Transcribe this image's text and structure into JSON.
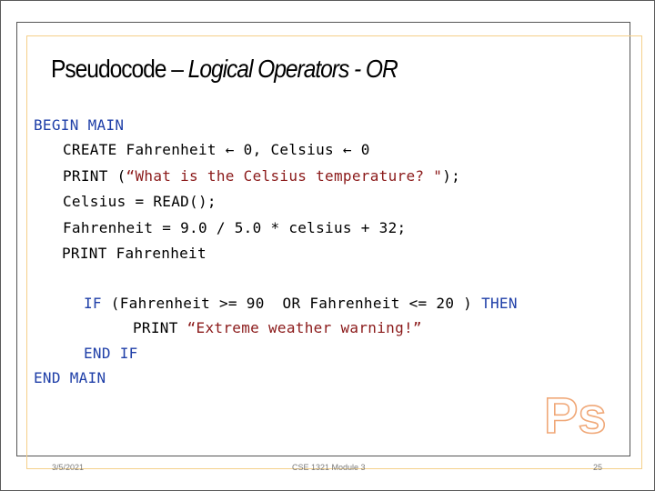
{
  "slide": {
    "title_plain": "Pseudocode – ",
    "title_italic": "Logical Operators - OR",
    "code": {
      "begin_main": "BEGIN MAIN",
      "line_create": "CREATE Fahrenheit ← 0, Celsius ← 0",
      "line_print_kw": "PRINT (",
      "line_print_str": "“What is the Celsius temperature? \"",
      "line_print_end": ");",
      "line_read": "Celsius = READ();",
      "line_calc": "Fahrenheit = 9.0 / 5.0 * celsius + 32;",
      "line_print_f": "PRINT Fahrenheit",
      "if_kw": "IF",
      "if_cond": " (Fahrenheit >= 90  OR Fahrenheit <= 20 ) ",
      "then_kw": "THEN",
      "inner_print": "PRINT ",
      "inner_str": "“Extreme weather warning!”",
      "end_if": "END IF",
      "end_main": "END MAIN"
    },
    "logo_text": "Ps",
    "colors": {
      "keyword": "#1f3fa8",
      "string": "#8b1a1a",
      "logo": "#f0a878",
      "gold_frame": "#f5d08a"
    },
    "footer": {
      "date": "3/5/2021",
      "course": "CSE 1321 Module 3",
      "page_number": "25"
    }
  }
}
